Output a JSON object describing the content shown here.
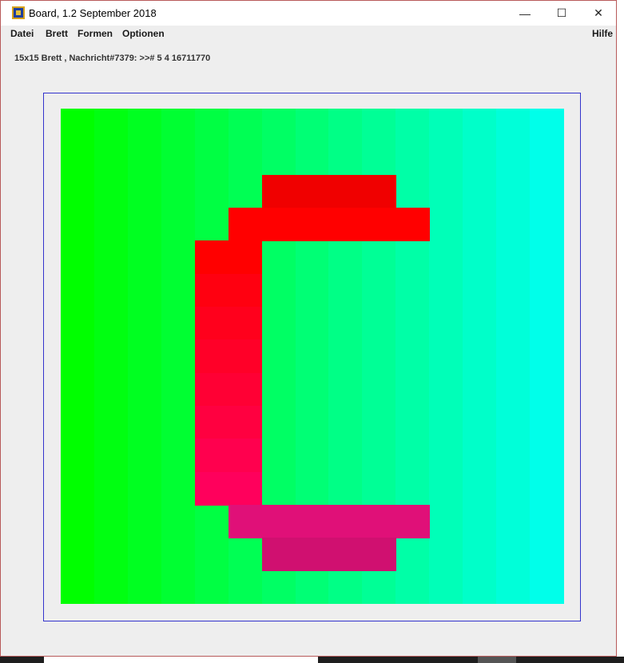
{
  "window": {
    "title": "Board, 1.2 September 2018",
    "controls": {
      "minimize": "—",
      "maximize": "☐",
      "close": "✕"
    }
  },
  "menu": {
    "items": [
      "Datei",
      "Brett",
      "Formen",
      "Optionen"
    ],
    "help": "Hilfe"
  },
  "status": "15x15 Brett , Nachricht#7379: >>#  5 4 16711770",
  "board": {
    "rows": 15,
    "cols": 15,
    "background_gradient": [
      "#00ff00",
      "#00ffea"
    ],
    "frame_color": "#3333cc",
    "shape_cells": [
      {
        "row": 2,
        "cols": [
          6,
          7,
          8,
          9
        ],
        "color": "#f00000"
      },
      {
        "row": 3,
        "cols": [
          5,
          6,
          7,
          8,
          9,
          10
        ],
        "color": "#ff0000"
      },
      {
        "row": 4,
        "cols": [
          4,
          5
        ],
        "color": "#ff0000"
      },
      {
        "row": 5,
        "cols": [
          4,
          5
        ],
        "color": "#ff0010"
      },
      {
        "row": 6,
        "cols": [
          4,
          5
        ],
        "color": "#ff001c"
      },
      {
        "row": 7,
        "cols": [
          4,
          5
        ],
        "color": "#ff0028"
      },
      {
        "row": 8,
        "cols": [
          4,
          5
        ],
        "color": "#ff0034"
      },
      {
        "row": 9,
        "cols": [
          4,
          5
        ],
        "color": "#ff0040"
      },
      {
        "row": 10,
        "cols": [
          4,
          5
        ],
        "color": "#ff004e"
      },
      {
        "row": 11,
        "cols": [
          4,
          5
        ],
        "color": "#ff005c"
      },
      {
        "row": 12,
        "cols": [
          5,
          6,
          7,
          8,
          9,
          10
        ],
        "color": "#e01078"
      },
      {
        "row": 13,
        "cols": [
          6,
          7,
          8,
          9
        ],
        "color": "#d01070"
      }
    ]
  }
}
